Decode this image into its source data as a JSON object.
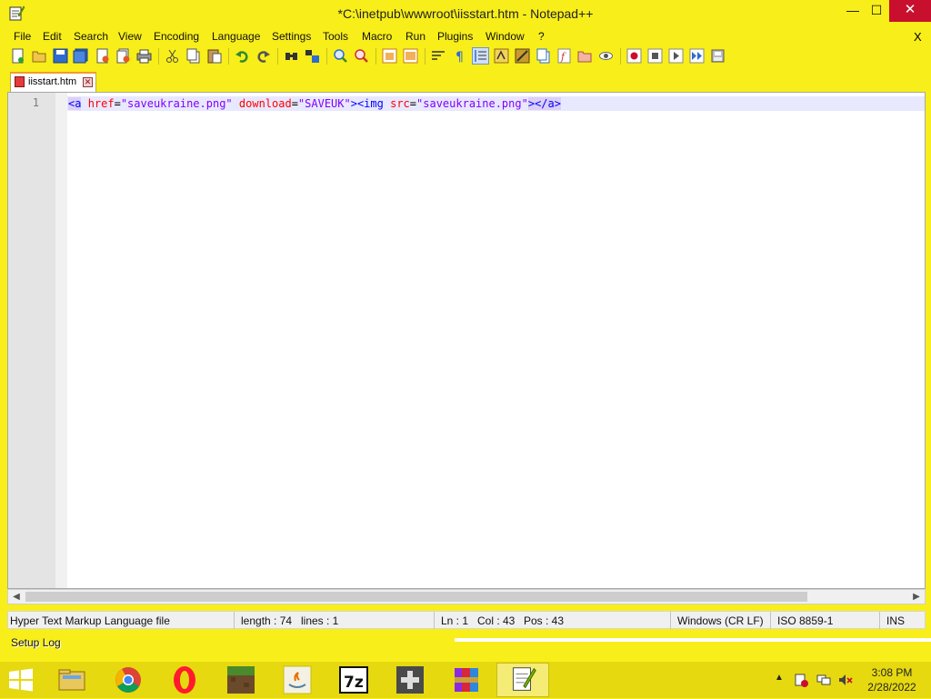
{
  "window": {
    "title": "*C:\\inetpub\\wwwroot\\iisstart.htm - Notepad++",
    "min_label": "—",
    "max_label": "☐",
    "close_label": "✕"
  },
  "menu": {
    "items": [
      "File",
      "Edit",
      "Search",
      "View",
      "Encoding",
      "Language",
      "Settings",
      "Tools",
      "Macro",
      "Run",
      "Plugins",
      "Window",
      "?"
    ],
    "close_doc": "X"
  },
  "toolbar": {
    "icons": [
      "new-file-icon",
      "open-file-icon",
      "save-icon",
      "save-all-icon",
      "close-icon",
      "close-all-icon",
      "print-icon",
      "cut-icon",
      "copy-icon",
      "paste-icon",
      "undo-icon",
      "redo-icon",
      "find-icon",
      "replace-icon",
      "zoom-in-icon",
      "zoom-out-icon",
      "sync-vertical-icon",
      "sync-horizontal-icon",
      "word-wrap-icon",
      "show-all-chars-icon",
      "indent-guide-icon",
      "user-language-icon",
      "doc-map-icon",
      "document-list-icon",
      "function-list-icon",
      "folder-workspace-icon",
      "monitoring-icon",
      "record-macro-icon",
      "stop-record-icon",
      "playback-icon",
      "run-macro-multiple-icon",
      "save-macro-icon"
    ]
  },
  "tab": {
    "label": "iisstart.htm",
    "close_label": "✕"
  },
  "editor": {
    "line_number": "1",
    "code": {
      "t1": "<a",
      "sp1": " ",
      "a1": "href",
      "eq1": "=",
      "s1": "\"saveukraine.png\"",
      "sp2": " ",
      "a2": "download",
      "eq2": "=",
      "s2": "\"SAVEUK\"",
      "t2": ">",
      "t3": "<img",
      "sp3": " ",
      "a3": "src",
      "eq3": "=",
      "s3": "\"saveukraine.png\"",
      "t4": "></a>"
    }
  },
  "statusbar": {
    "file_type": "Hyper Text Markup Language file",
    "length": "length : 74",
    "lines": "lines : 1",
    "ln": "Ln : 1",
    "col": "Col : 43",
    "pos": "Pos : 43",
    "eol": "Windows (CR LF)",
    "encoding": "ISO 8859-1",
    "mode": "INS"
  },
  "setup_log": {
    "label": "Setup Log"
  },
  "taskbar": {
    "apps": [
      "file-explorer-icon",
      "chrome-icon",
      "opera-icon",
      "minecraft-icon",
      "java-icon",
      "7zip-icon",
      "gamepad-icon",
      "winrar-icon",
      "notepadpp-icon"
    ],
    "tray": [
      "show-hidden-icons-chevron",
      "action-center-icon",
      "network-icon",
      "volume-muted-icon"
    ],
    "time": "3:08 PM",
    "date": "2/28/2022"
  },
  "colors": {
    "accent": "#f8ee1a",
    "taskbar": "#e6d90f",
    "close": "#c8102e"
  }
}
